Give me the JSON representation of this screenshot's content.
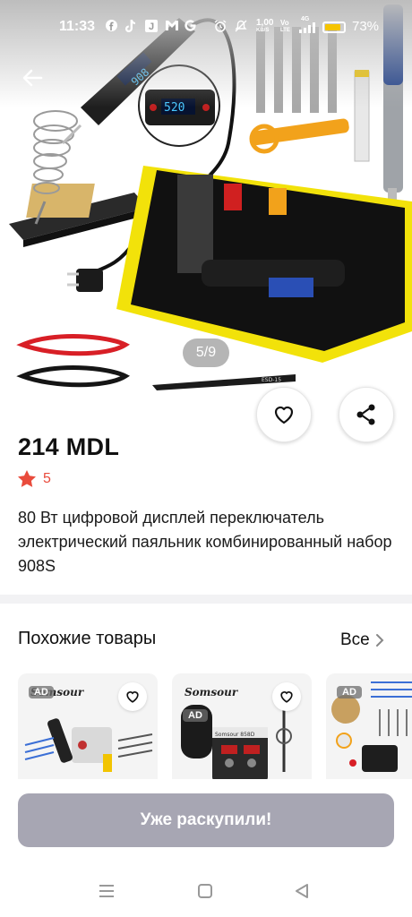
{
  "status_bar": {
    "time": "11:33",
    "network_speed_value": "1,00",
    "network_speed_unit": "KB/S",
    "volte_top": "Vo",
    "volte_bottom": "LTE",
    "signal_label": "4G",
    "battery_percent": "73%",
    "battery_level": 0.73,
    "icons": [
      "facebook-icon",
      "tiktok-icon",
      "j-app-icon",
      "gmail-icon",
      "google-icon",
      "alarm-icon",
      "mute-icon",
      "wifi-icon",
      "signal-icon",
      "battery-icon"
    ]
  },
  "gallery": {
    "counter": "5/9",
    "image_text": {
      "display_reading_main": "908",
      "display_reading_zoom": "520",
      "tweezers_label": "ESD-15"
    }
  },
  "product": {
    "price": "214 MDL",
    "rating": "5",
    "title": "80 Вт цифровой дисплей переключатель электрический паяльник комбинированный набор 908S"
  },
  "similar": {
    "heading": "Похожие товары",
    "see_all": "Все",
    "cards": [
      {
        "brand": "Somsour",
        "ad_badge": "AD"
      },
      {
        "brand": "Somsour",
        "ad_badge": "AD",
        "device_label": "Somsour 858D"
      },
      {
        "ad_badge": "AD"
      }
    ]
  },
  "actions": {
    "sold_out_label": "Уже раскупили!"
  },
  "colors": {
    "accent_star": "#e94b3c",
    "button_disabled": "#a7a6b3",
    "case_yellow": "#f2e20a"
  }
}
